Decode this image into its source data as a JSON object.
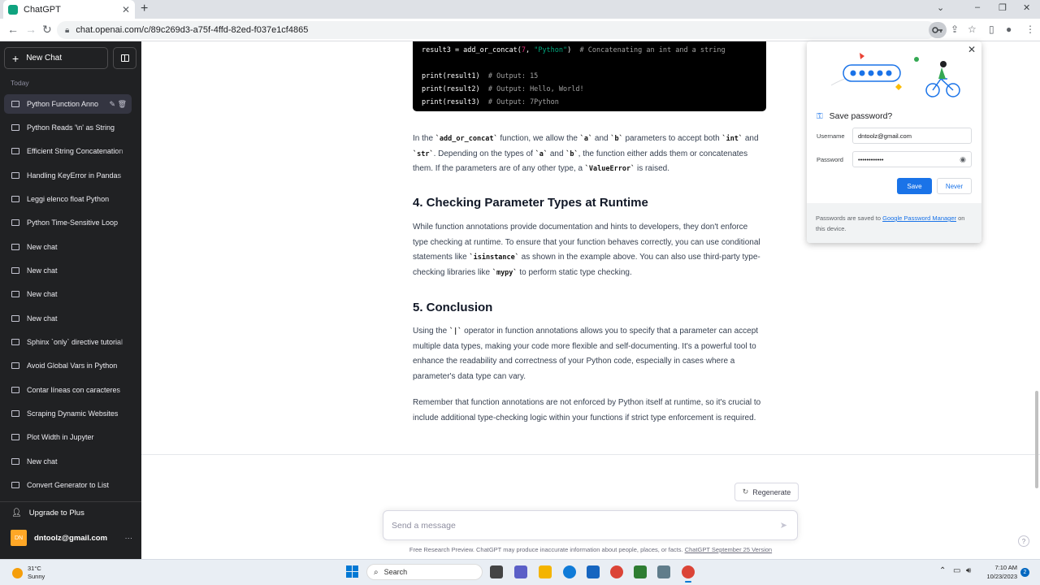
{
  "browser": {
    "tab_title": "ChatGPT",
    "tab_close": "✕",
    "new_tab": "+",
    "url": "chat.openai.com/c/89c269d3-a75f-4ffd-82ed-f037e1cf4865",
    "win_min": "–",
    "win_max": "❐",
    "win_close": "✕",
    "win_chevron": "⌄"
  },
  "sidebar": {
    "new_chat_label": "New Chat",
    "section_label": "Today",
    "items": [
      {
        "label": "Python Function Anno"
      },
      {
        "label": "Python Reads '\\n' as String"
      },
      {
        "label": "Efficient String Concatenation"
      },
      {
        "label": "Handling KeyError in Pandas"
      },
      {
        "label": "Leggi elenco float Python"
      },
      {
        "label": "Python Time-Sensitive Loop"
      },
      {
        "label": "New chat"
      },
      {
        "label": "New chat"
      },
      {
        "label": "New chat"
      },
      {
        "label": "New chat"
      },
      {
        "label": "Sphinx `only` directive tutorial"
      },
      {
        "label": "Avoid Global Vars in Python"
      },
      {
        "label": "Contar líneas con caracteres"
      },
      {
        "label": "Scraping Dynamic Websites"
      },
      {
        "label": "Plot Width in Jupyter"
      },
      {
        "label": "New chat"
      },
      {
        "label": "Convert Generator to List"
      }
    ],
    "upgrade_label": "Upgrade to Plus",
    "user_initials": "DN",
    "user_email": "dntoolz@gmail.com",
    "more": "···"
  },
  "main": {
    "code_lines": [
      {
        "pre": "result3 = add_or_concat(",
        "num": "7",
        "mid": ", ",
        "str": "\"Python\"",
        "post": ")  ",
        "comment": "# Concatenating an int and a string"
      },
      {
        "pre": "print(result1)  ",
        "comment": "# Output: 15"
      },
      {
        "pre": "print(result2)  ",
        "comment": "# Output: Hello, World!"
      },
      {
        "pre": "print(result3)  ",
        "comment": "# Output: 7Python"
      }
    ],
    "para1": {
      "t1": "In the ",
      "c1": "`add_or_concat`",
      "t2": " function, we allow the ",
      "c2": "`a`",
      "t3": " and ",
      "c3": "`b`",
      "t4": " parameters to accept both ",
      "c4": "`int`",
      "t5": " and ",
      "c5": "`str`",
      "t6": ". Depending on the types of ",
      "c6": "`a`",
      "t7": " and ",
      "c7": "`b`",
      "t8": ", the function either adds them or concatenates them. If the parameters are of any other type, a ",
      "c8": "`ValueError`",
      "t9": " is raised."
    },
    "heading4": "4. Checking Parameter Types at Runtime",
    "para2": {
      "t1": "While function annotations provide documentation and hints to developers, they don't enforce type checking at runtime. To ensure that your function behaves correctly, you can use conditional statements like ",
      "c1": "`isinstance`",
      "t2": " as shown in the example above. You can also use third-party type-checking libraries like ",
      "c2": "`mypy`",
      "t3": " to perform static type checking."
    },
    "heading5": "5. Conclusion",
    "para3": {
      "t1": "Using the ",
      "c1": "`|`",
      "t2": " operator in function annotations allows you to specify that a parameter can accept multiple data types, making your code more flexible and self-documenting. It's a powerful tool to enhance the readability and correctness of your Python code, especially in cases where a parameter's data type can vary."
    },
    "para4": "Remember that function annotations are not enforced by Python itself at runtime, so it's crucial to include additional type-checking logic within your functions if strict type enforcement is required.",
    "regenerate_label": "Regenerate",
    "input_placeholder": "Send a message",
    "footer_text": "Free Research Preview. ChatGPT may produce inaccurate information about people, places, or facts. ",
    "footer_link": "ChatGPT September 25 Version",
    "help": "?"
  },
  "password_popup": {
    "title": "Save password?",
    "username_label": "Username",
    "username_value": "dntoolz@gmail.com",
    "password_label": "Password",
    "password_value": "••••••••••••",
    "save_label": "Save",
    "never_label": "Never",
    "footer_text": "Passwords are saved to ",
    "footer_link": "Google Password Manager",
    "footer_tail": " on this device."
  },
  "taskbar": {
    "temperature": "31°C",
    "condition": "Sunny",
    "search_label": "Search",
    "time": "7:10 AM",
    "date": "10/23/2023",
    "notification_count": "2"
  },
  "colors": {
    "sidebar_bg": "#202123",
    "accent": "#10a37f",
    "save_button": "#1a73e8"
  }
}
